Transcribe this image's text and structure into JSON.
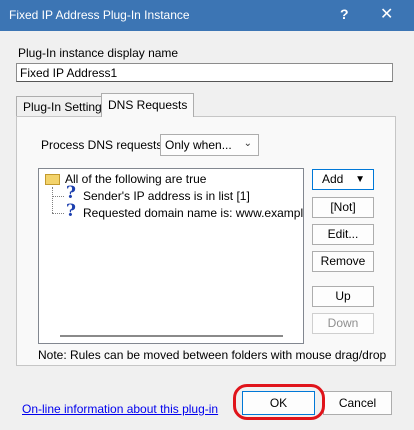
{
  "window": {
    "title": "Fixed IP Address Plug-In Instance",
    "help_symbol": "?",
    "close_symbol": "✕"
  },
  "display_name": {
    "label": "Plug-In instance display name",
    "value": "Fixed IP Address1"
  },
  "tabs": [
    {
      "label": "Plug-In Settings",
      "active": false
    },
    {
      "label": "DNS Requests",
      "active": true
    }
  ],
  "process": {
    "label": "Process DNS requests:",
    "selected": "Only when..."
  },
  "tree": {
    "root": {
      "label": "All of the following are true",
      "icon": "folder-icon"
    },
    "children": [
      {
        "label": "Sender's IP address is in list [1]",
        "icon": "question-icon"
      },
      {
        "label": "Requested domain name is: www.example.com",
        "icon": "question-icon"
      }
    ]
  },
  "side_buttons": {
    "add": "Add",
    "add_arrow": "▼",
    "not": "[Not]",
    "edit": "Edit...",
    "remove": "Remove",
    "up": "Up",
    "down": "Down"
  },
  "note": "Note: Rules can be moved between folders with mouse drag/drop",
  "footer": {
    "link": "On-line information about this plug-in",
    "ok": "OK",
    "cancel": "Cancel"
  },
  "colors": {
    "titlebar": "#3c75b4",
    "annotation_circle": "#e0141b",
    "focus_border": "#0078d7"
  }
}
